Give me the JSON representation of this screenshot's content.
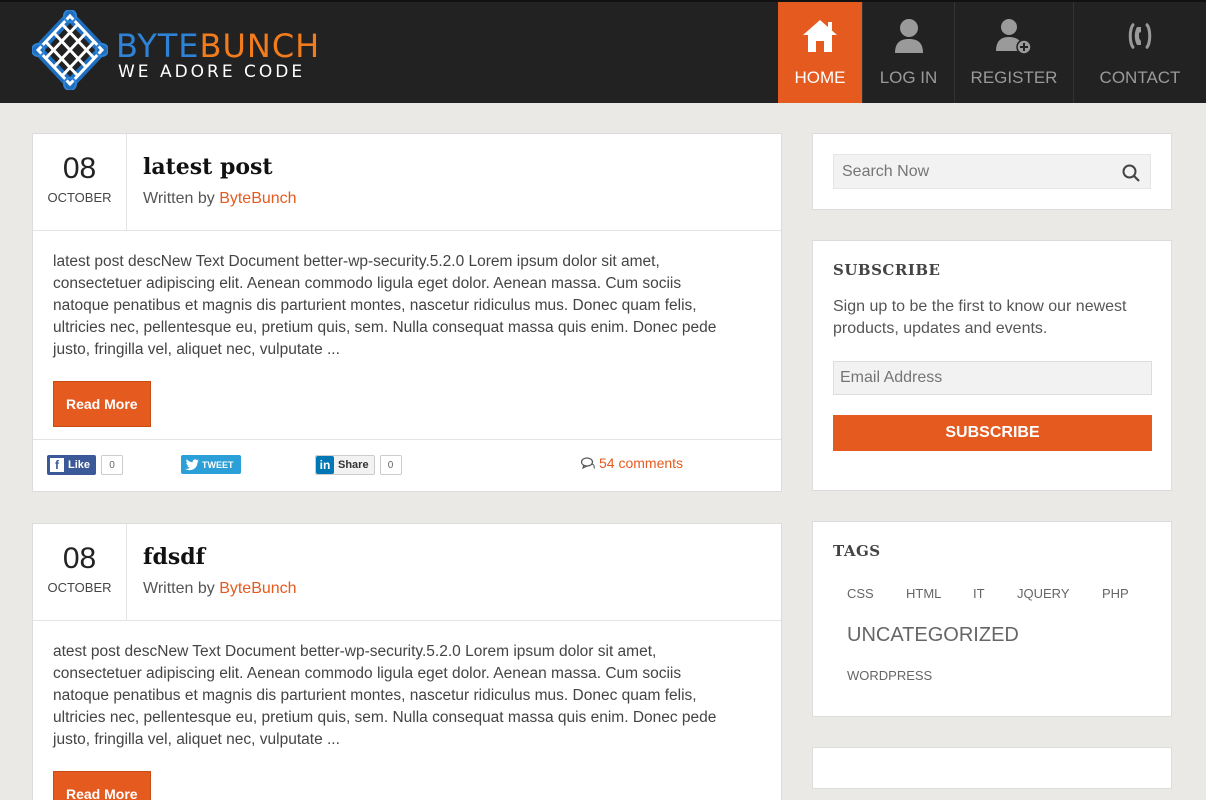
{
  "brand": {
    "title_part1": "BYTE",
    "title_part2": "BUNCH",
    "tagline": "WE ADORE CODE",
    "accent_color": "#e55a1f"
  },
  "nav": {
    "items": [
      {
        "label": "HOME",
        "icon": "home-icon",
        "active": true
      },
      {
        "label": "LOG IN",
        "icon": "user-icon",
        "active": false
      },
      {
        "label": "REGISTER",
        "icon": "user-add-icon",
        "active": false
      },
      {
        "label": "CONTACT",
        "icon": "phone-icon",
        "active": false
      }
    ]
  },
  "posts": [
    {
      "day": "08",
      "month": "OCTOBER",
      "title": "latest post",
      "written_by": "Written by",
      "author": "ByteBunch",
      "lines": [
        "latest post descNew Text Document better-wp-security.5.2.0 Lorem ipsum dolor sit amet,",
        "consectetuer adipiscing elit. Aenean commodo ligula eget dolor. Aenean massa. Cum sociis",
        "natoque penatibus et magnis dis parturient montes, nascetur ridiculus mus. Donec quam felis,",
        "ultricies nec, pellentesque eu, pretium quis, sem. Nulla consequat massa quis enim. Donec pede",
        "justo, fringilla vel, aliquet nec, vulputate ..."
      ],
      "read_more": "Read More",
      "like_label": "Like",
      "like_count": "0",
      "tweet_label": "TWEET",
      "share_label": "Share",
      "share_count": "0",
      "comments": "54 comments"
    },
    {
      "day": "08",
      "month": "OCTOBER",
      "title": "fdsdf",
      "written_by": "Written by",
      "author": "ByteBunch",
      "lines": [
        "atest post descNew Text Document better-wp-security.5.2.0 Lorem ipsum dolor sit amet,",
        "consectetuer adipiscing elit. Aenean commodo ligula eget dolor. Aenean massa. Cum sociis",
        "natoque penatibus et magnis dis parturient montes, nascetur ridiculus mus. Donec quam felis,",
        "ultricies nec, pellentesque eu, pretium quis, sem. Nulla consequat massa quis enim. Donec pede",
        "justo, fringilla vel, aliquet nec, vulputate ..."
      ],
      "read_more": "Read More"
    }
  ],
  "sidebar": {
    "search": {
      "placeholder": "Search Now"
    },
    "subscribe": {
      "title": "SUBSCRIBE",
      "text_line1": "Sign up to be the first to know our newest",
      "text_line2": "products, updates and events.",
      "email_placeholder": "Email Address",
      "button": "SUBSCRIBE"
    },
    "tags": {
      "title": "TAGS",
      "items": [
        "CSS",
        "HTML",
        "IT",
        "JQUERY",
        "PHP",
        "UNCATEGORIZED",
        "WORDPRESS"
      ]
    }
  }
}
